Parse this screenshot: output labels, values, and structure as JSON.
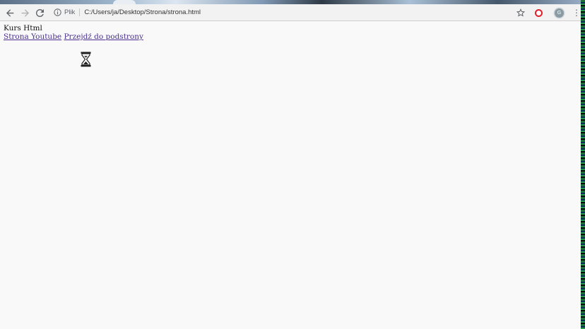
{
  "browser": {
    "origin_label": "Plik",
    "url": "C:/Users/ja/Desktop/Strona/strona.html",
    "avatar_letter": "G"
  },
  "page": {
    "heading": "Kurs Html",
    "link_youtube": "Strona Youtube",
    "link_subpage": "Przejdź do podstrony"
  },
  "icons": {
    "back": "back-arrow-icon",
    "forward": "forward-arrow-icon",
    "reload": "reload-icon",
    "info": "info-icon",
    "star": "star-icon",
    "opera": "opera-icon",
    "menu": "kebab-menu-icon",
    "cursor": "hourglass-cursor-icon"
  },
  "colors": {
    "page_background": "#f9f9f9",
    "link": "#4b2f8f",
    "toolbar": "#f2f2f2"
  }
}
